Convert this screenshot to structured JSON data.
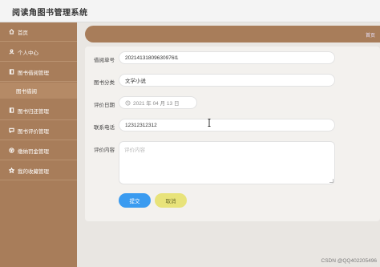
{
  "app": {
    "title": "阅读角图书管理系统"
  },
  "sidebar": {
    "items": [
      {
        "label": "首页",
        "icon": "home-icon"
      },
      {
        "label": "个人中心",
        "icon": "user-icon"
      },
      {
        "label": "图书借阅管理",
        "icon": "book-icon"
      },
      {
        "label": "图书借阅",
        "icon": ""
      },
      {
        "label": "图书归还管理",
        "icon": "book-icon"
      },
      {
        "label": "图书评价管理",
        "icon": "comment-icon"
      },
      {
        "label": "缴纳罚金管理",
        "icon": "money-icon"
      },
      {
        "label": "我的收藏管理",
        "icon": "star-icon"
      }
    ]
  },
  "breadcrumb": {
    "link": "首页"
  },
  "form": {
    "borrow_no": {
      "label": "借阅单号",
      "value": "20214131809630976l1"
    },
    "category": {
      "label": "图书分类",
      "value": "文学小说"
    },
    "review_date": {
      "label": "评价日期",
      "value": "2021 年 04 月 13 日"
    },
    "phone": {
      "label": "联系电话",
      "value": "12312312312"
    },
    "review_content": {
      "label": "评价内容",
      "placeholder": "评价内容"
    }
  },
  "buttons": {
    "submit": "提交",
    "cancel": "取消"
  },
  "watermark": "CSDN @QQ402205496",
  "colors": {
    "sidebar": "#a87d5a",
    "submit": "#3a9bf0",
    "cancel": "#e8e37a",
    "background": "#e9e6e2"
  }
}
